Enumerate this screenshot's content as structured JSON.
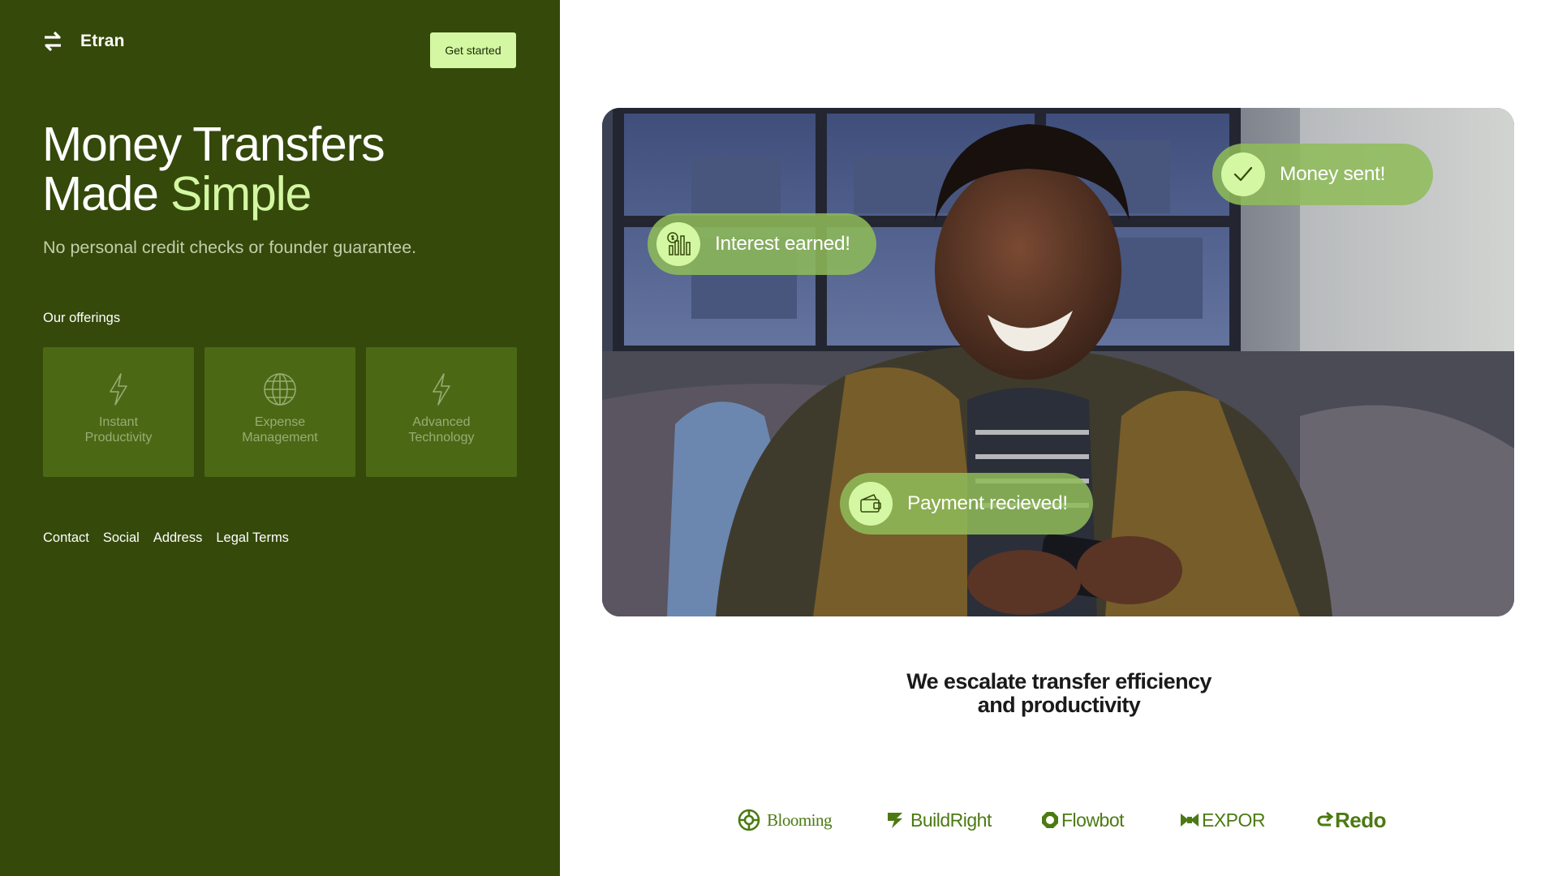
{
  "brand": {
    "name": "Etran",
    "icon": "swap-arrows-icon"
  },
  "header": {
    "cta_label": "Get started"
  },
  "hero": {
    "title_line1": "Money Transfers",
    "title_line2_prefix": "Made ",
    "title_line2_accent": "Simple",
    "subtitle": "No personal credit checks or founder guarantee."
  },
  "offerings": {
    "heading": "Our offerings",
    "items": [
      {
        "label": "Instant Productivity",
        "icon": "lightning-icon"
      },
      {
        "label": "Expense Management",
        "icon": "globe-icon"
      },
      {
        "label": "Advanced Technology",
        "icon": "lightning-icon"
      }
    ]
  },
  "footer": {
    "links": [
      "Contact",
      "Social",
      "Address",
      "Legal Terms"
    ]
  },
  "notifications": {
    "money_sent": {
      "text": "Money sent!",
      "icon": "check-icon"
    },
    "interest": {
      "text": "Interest earned!",
      "icon": "chart-bars-icon"
    },
    "payment": {
      "text": "Payment recieved!",
      "icon": "wallet-icon"
    }
  },
  "tagline": {
    "line1": "We escalate transfer efficiency",
    "line2": "and productivity"
  },
  "partners": [
    {
      "name": "Blooming",
      "icon": "blooming-logo-icon"
    },
    {
      "name": "BuildRight",
      "icon": "buildright-logo-icon"
    },
    {
      "name": "Flowbot",
      "icon": "flowbot-logo-icon"
    },
    {
      "name": "EXPOR",
      "icon": "expor-logo-icon"
    },
    {
      "name": "Redo",
      "icon": "redo-logo-icon"
    }
  ],
  "colors": {
    "panel": "#35490a",
    "accent": "#d3f7a2",
    "card": "#4b6915",
    "logo": "#4c7a12"
  }
}
